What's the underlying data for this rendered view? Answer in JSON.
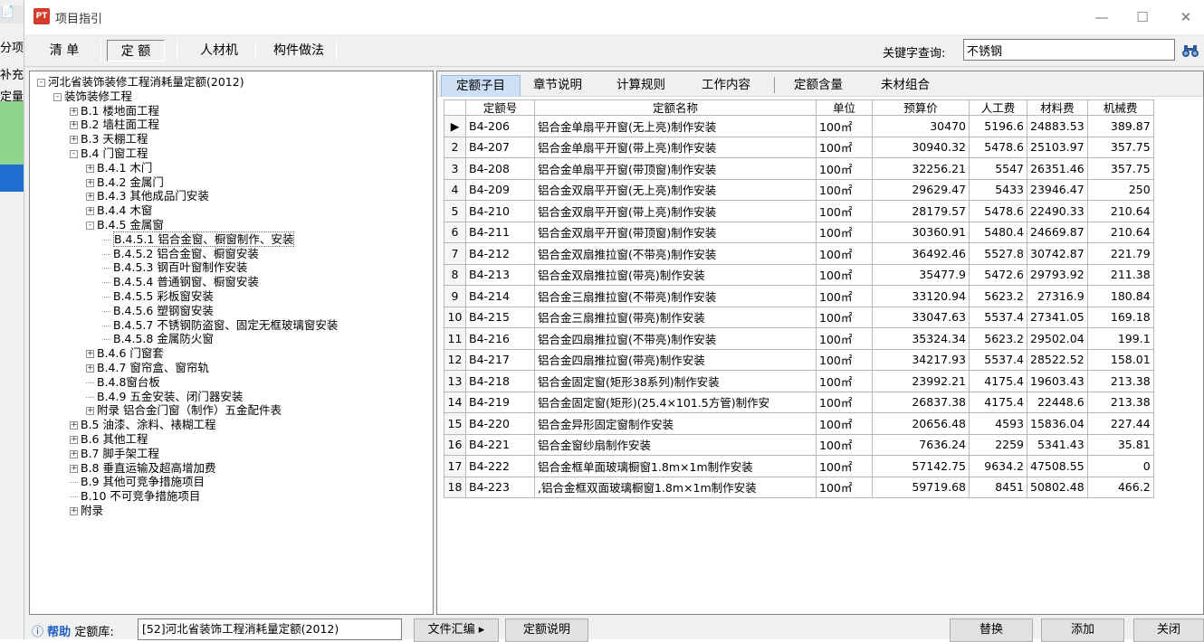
{
  "left_strip": {
    "items": [
      "分项",
      "补充",
      "定量表"
    ]
  },
  "window": {
    "title": "项目指引",
    "min_glyph": "—",
    "max_glyph": "☐",
    "close_glyph": "✕",
    "app_icon_text": "PT"
  },
  "toolbar": {
    "tabs": [
      "清 单",
      "定 额",
      "人材机",
      "构件做法"
    ],
    "keyword_label": "关键字查询:",
    "keyword_value": "不锈钢"
  },
  "tree": [
    {
      "label": "河北省装饰装修工程消耗量定额(2012)",
      "exp": "-",
      "level": 0
    },
    {
      "label": "装饰装修工程",
      "exp": "-",
      "level": 1
    },
    {
      "label": "B.1 楼地面工程",
      "exp": "+",
      "level": 2
    },
    {
      "label": "B.2 墙柱面工程",
      "exp": "+",
      "level": 2
    },
    {
      "label": "B.3 天棚工程",
      "exp": "+",
      "level": 2
    },
    {
      "label": "B.4 门窗工程",
      "exp": "-",
      "level": 2
    },
    {
      "label": "B.4.1 木门",
      "exp": "+",
      "level": 3
    },
    {
      "label": "B.4.2 金属门",
      "exp": "+",
      "level": 3
    },
    {
      "label": "B.4.3 其他成品门安装",
      "exp": "+",
      "level": 3
    },
    {
      "label": "B.4.4 木窗",
      "exp": "+",
      "level": 3
    },
    {
      "label": "B.4.5 金属窗",
      "exp": "-",
      "level": 3
    },
    {
      "label": "B.4.5.1 铝合金窗、橱窗制作、安装",
      "exp": "",
      "level": 4,
      "sel": true
    },
    {
      "label": "B.4.5.2 铝合金窗、橱窗安装",
      "exp": "",
      "level": 4
    },
    {
      "label": "B.4.5.3 钢百叶窗制作安装",
      "exp": "",
      "level": 4
    },
    {
      "label": "B.4.5.4 普通钢窗、橱窗安装",
      "exp": "",
      "level": 4
    },
    {
      "label": "B.4.5.5 彩板窗安装",
      "exp": "",
      "level": 4
    },
    {
      "label": "B.4.5.6 塑钢窗安装",
      "exp": "",
      "level": 4
    },
    {
      "label": "B.4.5.7 不锈钢防盗窗、固定无框玻璃窗安装",
      "exp": "",
      "level": 4
    },
    {
      "label": "B.4.5.8 金属防火窗",
      "exp": "",
      "level": 4
    },
    {
      "label": "B.4.6 门窗套",
      "exp": "+",
      "level": 3
    },
    {
      "label": "B.4.7 窗帘盒、窗帘轨",
      "exp": "+",
      "level": 3
    },
    {
      "label": "B.4.8窗台板",
      "exp": "",
      "level": 3
    },
    {
      "label": "B.4.9 五金安装、闭门器安装",
      "exp": "",
      "level": 3
    },
    {
      "label": "附录 铝合金门窗（制作）五金配件表",
      "exp": "+",
      "level": 3
    },
    {
      "label": "B.5 油漆、涂料、裱糊工程",
      "exp": "+",
      "level": 2
    },
    {
      "label": "B.6 其他工程",
      "exp": "+",
      "level": 2
    },
    {
      "label": "B.7 脚手架工程",
      "exp": "+",
      "level": 2
    },
    {
      "label": "B.8 垂直运输及超高增加费",
      "exp": "+",
      "level": 2
    },
    {
      "label": "B.9 其他可竞争措施项目",
      "exp": "",
      "level": 2
    },
    {
      "label": "B.10 不可竞争措施项目",
      "exp": "",
      "level": 2
    },
    {
      "label": "附录",
      "exp": "+",
      "level": 2
    }
  ],
  "grid_tabs": [
    "定额子目",
    "章节说明",
    "计算规则",
    "工作内容",
    "定额含量",
    "未材组合"
  ],
  "grid": {
    "headers": [
      "定额号",
      "定额名称",
      "单位",
      "预算价",
      "人工费",
      "材料费",
      "机械费"
    ],
    "rows": [
      [
        "B4-206",
        "铝合金单扇平开窗(无上亮)制作安装",
        "100㎡",
        "30470",
        "5196.6",
        "24883.53",
        "389.87"
      ],
      [
        "B4-207",
        "铝合金单扇平开窗(带上亮)制作安装",
        "100㎡",
        "30940.32",
        "5478.6",
        "25103.97",
        "357.75"
      ],
      [
        "B4-208",
        "铝合金单扇平开窗(带顶窗)制作安装",
        "100㎡",
        "32256.21",
        "5547",
        "26351.46",
        "357.75"
      ],
      [
        "B4-209",
        "铝合金双扇平开窗(无上亮)制作安装",
        "100㎡",
        "29629.47",
        "5433",
        "23946.47",
        "250"
      ],
      [
        "B4-210",
        "铝合金双扇平开窗(带上亮)制作安装",
        "100㎡",
        "28179.57",
        "5478.6",
        "22490.33",
        "210.64"
      ],
      [
        "B4-211",
        "铝合金双扇平开窗(带顶窗)制作安装",
        "100㎡",
        "30360.91",
        "5480.4",
        "24669.87",
        "210.64"
      ],
      [
        "B4-212",
        "铝合金双扇推拉窗(不带亮)制作安装",
        "100㎡",
        "36492.46",
        "5527.8",
        "30742.87",
        "221.79"
      ],
      [
        "B4-213",
        "铝合金双扇推拉窗(带亮)制作安装",
        "100㎡",
        "35477.9",
        "5472.6",
        "29793.92",
        "211.38"
      ],
      [
        "B4-214",
        "铝合金三扇推拉窗(不带亮)制作安装",
        "100㎡",
        "33120.94",
        "5623.2",
        "27316.9",
        "180.84"
      ],
      [
        "B4-215",
        "铝合金三扇推拉窗(带亮)制作安装",
        "100㎡",
        "33047.63",
        "5537.4",
        "27341.05",
        "169.18"
      ],
      [
        "B4-216",
        "铝合金四扇推拉窗(不带亮)制作安装",
        "100㎡",
        "35324.34",
        "5623.2",
        "29502.04",
        "199.1"
      ],
      [
        "B4-217",
        "铝合金四扇推拉窗(带亮)制作安装",
        "100㎡",
        "34217.93",
        "5537.4",
        "28522.52",
        "158.01"
      ],
      [
        "B4-218",
        "铝合金固定窗(矩形38系列)制作安装",
        "100㎡",
        "23992.21",
        "4175.4",
        "19603.43",
        "213.38"
      ],
      [
        "B4-219",
        "铝合金固定窗(矩形)(25.4×101.5方管)制作安",
        "100㎡",
        "26837.38",
        "4175.4",
        "22448.6",
        "213.38"
      ],
      [
        "B4-220",
        "铝合金异形固定窗制作安装",
        "100㎡",
        "20656.48",
        "4593",
        "15836.04",
        "227.44"
      ],
      [
        "B4-221",
        "铝合金窗纱扇制作安装",
        "100㎡",
        "7636.24",
        "2259",
        "5341.43",
        "35.81"
      ],
      [
        "B4-222",
        "铝合金框单面玻璃橱窗1.8m×1m制作安装",
        "100㎡",
        "57142.75",
        "9634.2",
        "47508.55",
        "0"
      ],
      [
        "B4-223",
        ",铝合金框双面玻璃橱窗1.8m×1m制作安装",
        "100㎡",
        "59719.68",
        "8451",
        "50802.48",
        "466.2"
      ]
    ]
  },
  "bottom": {
    "help_label": "帮助",
    "lib_label": "定额库:",
    "lib_value": "[52]河北省装饰工程消耗量定额(2012)",
    "btn_file": "文件汇编",
    "btn_desc": "定额说明",
    "btn_replace": "替换",
    "btn_add": "添加",
    "btn_close": "关闭"
  }
}
